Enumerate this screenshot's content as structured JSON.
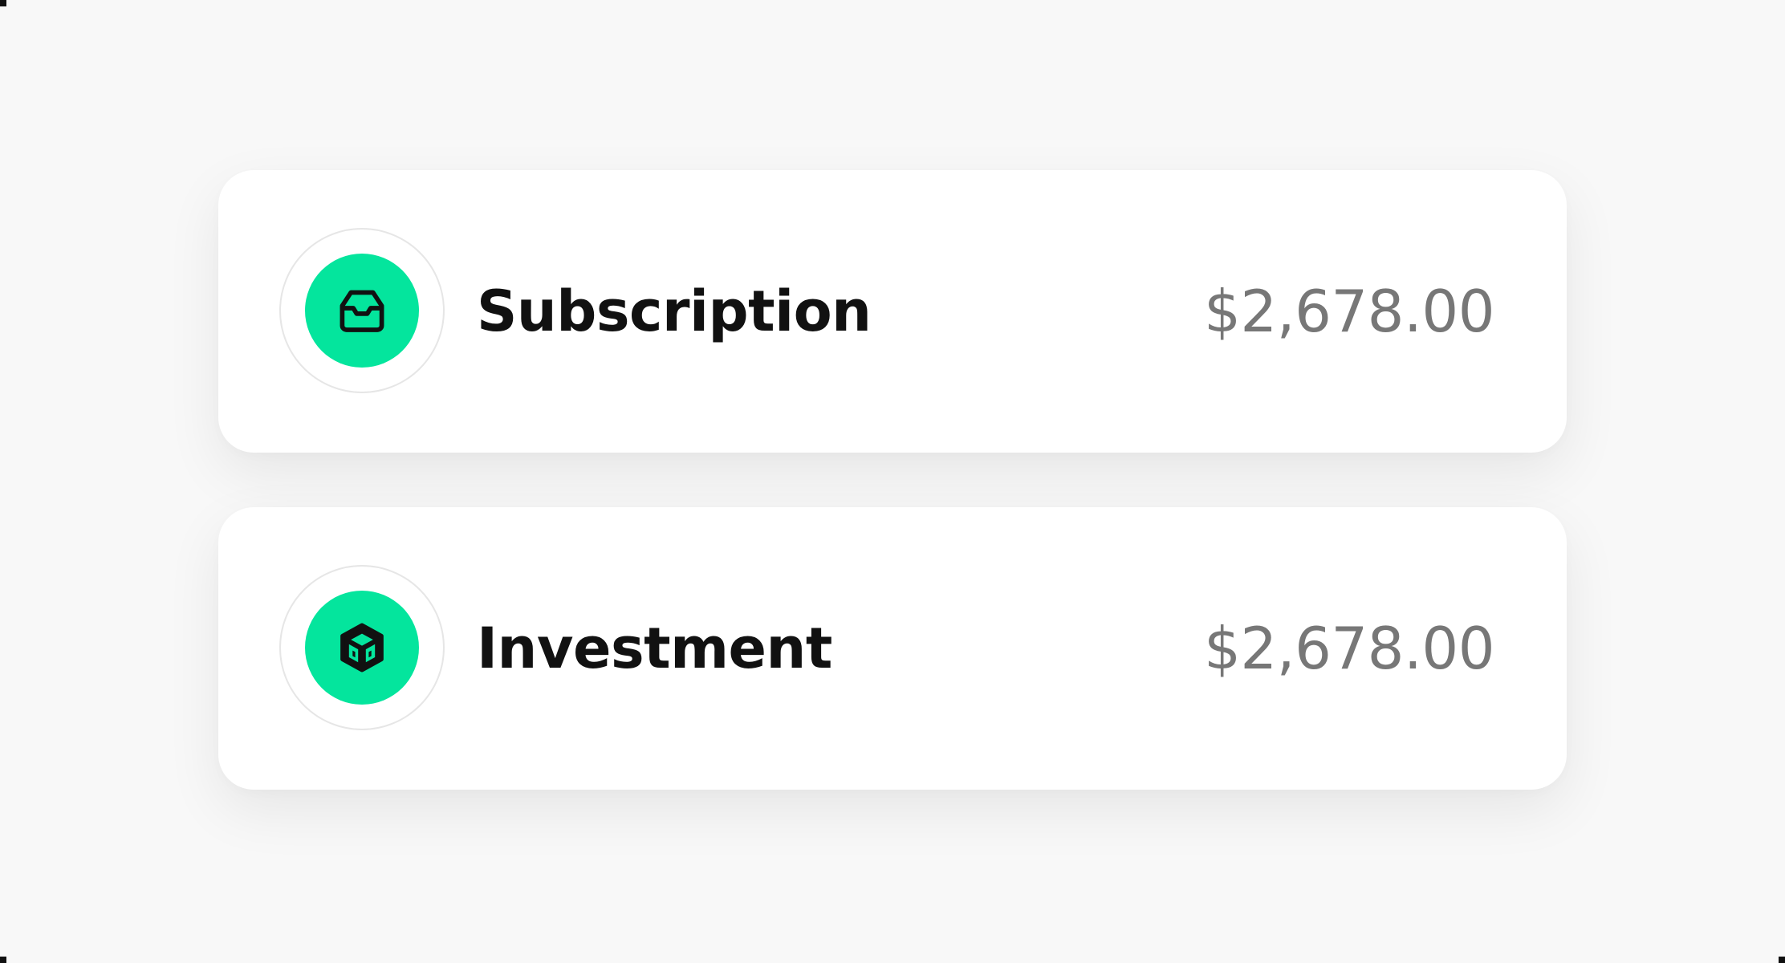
{
  "colors": {
    "accent": "#04e59d",
    "amount_text": "#777777",
    "label_text": "#111111"
  },
  "transactions": [
    {
      "label": "Subscription",
      "amount": "$2,678.00",
      "icon": "inbox-icon"
    },
    {
      "label": "Investment",
      "amount": "$2,678.00",
      "icon": "cube-icon"
    }
  ]
}
